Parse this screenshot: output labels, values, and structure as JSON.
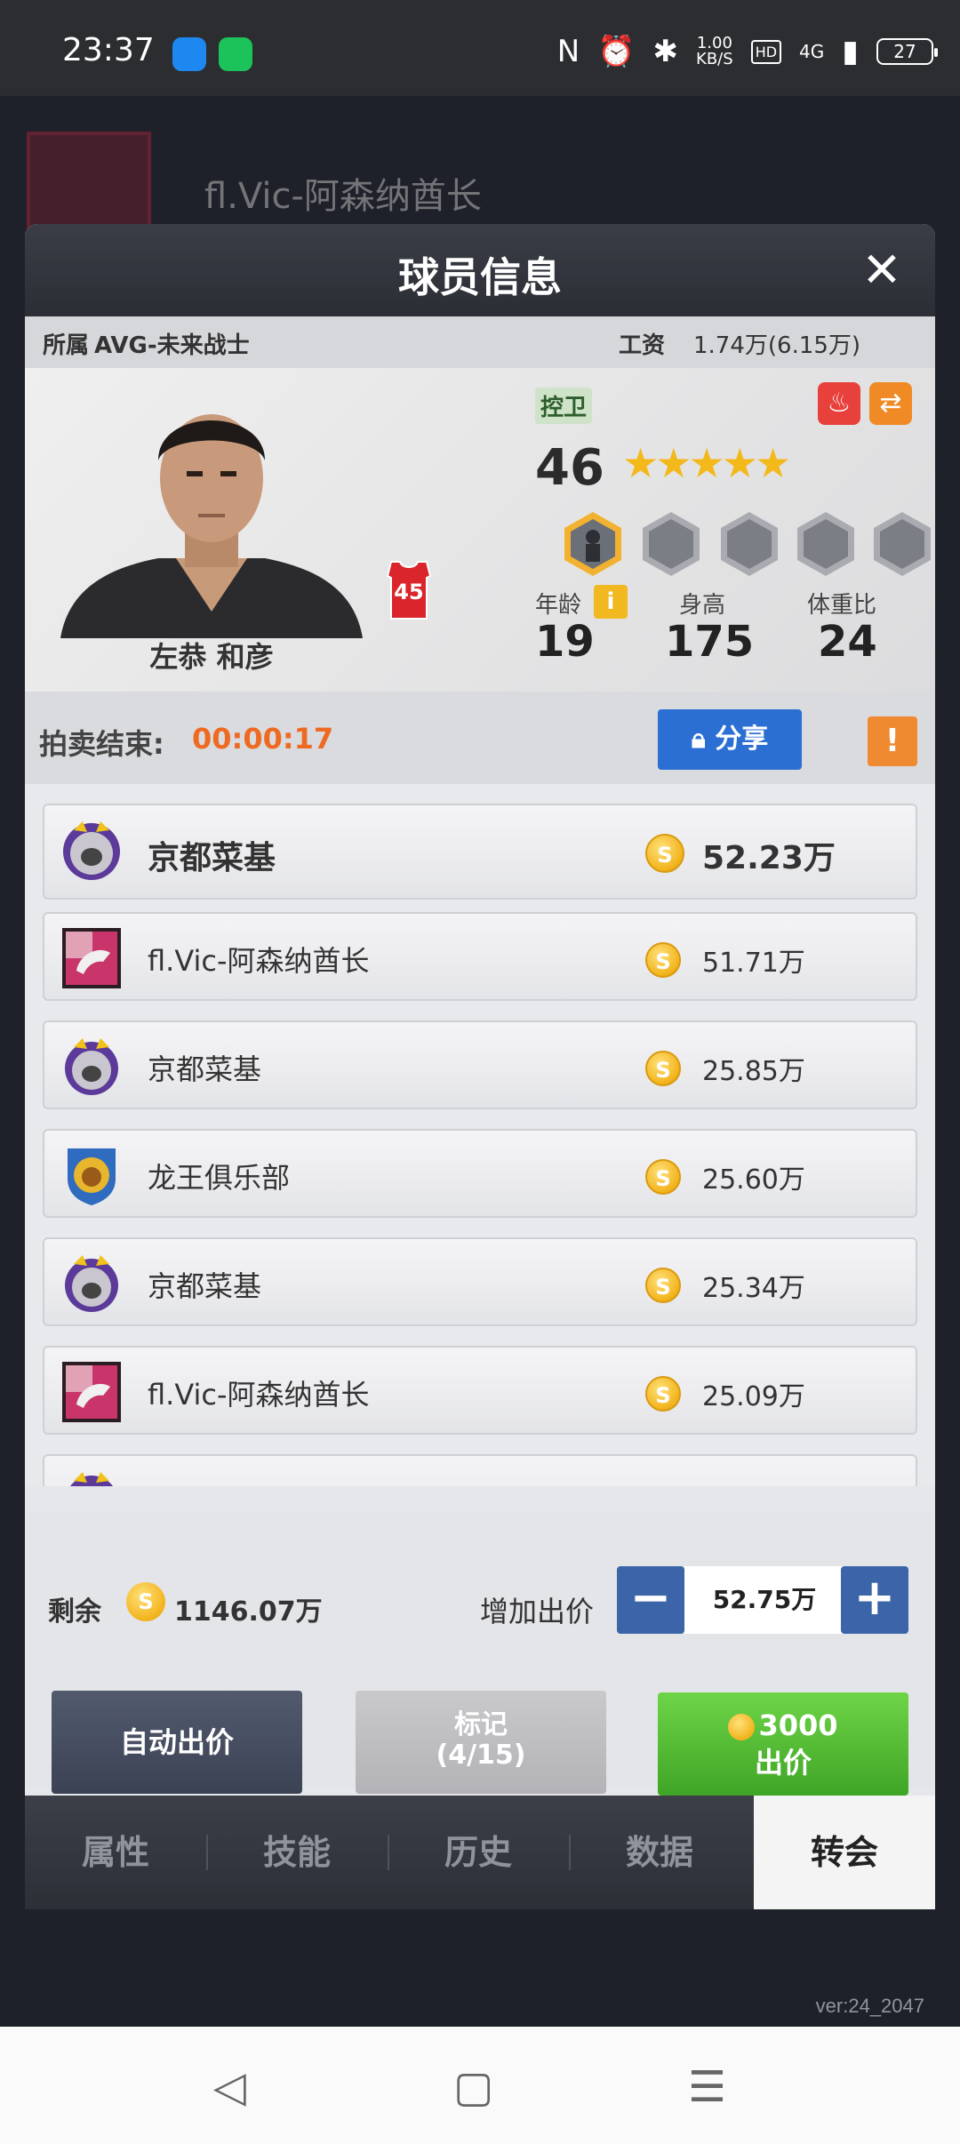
{
  "status_bar": {
    "time": "23:37",
    "speed_value": "1.00",
    "speed_unit": "KB/S",
    "hd": "HD",
    "network": "4G",
    "battery": "27"
  },
  "background": {
    "team_name": "fl.Vic-阿森纳酋长",
    "version": "ver:24_2047"
  },
  "modal": {
    "title": "球员信息",
    "close": "✕",
    "info": {
      "team_label": "所属",
      "team_value": "AVG-未来战士",
      "salary_label": "工资",
      "salary_value": "1.74万(6.15万)"
    },
    "player": {
      "name": "左恭 和彦",
      "jersey_number": "45",
      "position": "控卫",
      "rating": "46",
      "stars": 4.5,
      "stars_text": "★★★★★",
      "age_label": "年龄",
      "age_value": "19",
      "height_label": "身高",
      "height_value": "175",
      "weight_label": "体重比",
      "weight_value": "24",
      "info_icon": "i"
    },
    "auction": {
      "label": "拍卖结束:",
      "time": "00:00:17",
      "share_label": "分享",
      "warn": "!"
    },
    "bids": [
      {
        "team": "京都菜基",
        "amount": "52.23万",
        "logo": "wolf-logo"
      },
      {
        "team": "fl.Vic-阿森纳酋长",
        "amount": "51.71万",
        "logo": "dragon-logo"
      },
      {
        "team": "京都菜基",
        "amount": "25.85万",
        "logo": "wolf-logo"
      },
      {
        "team": "龙王俱乐部",
        "amount": "25.60万",
        "logo": "lion-logo"
      },
      {
        "team": "京都菜基",
        "amount": "25.34万",
        "logo": "wolf-logo"
      },
      {
        "team": "fl.Vic-阿森纳酋长",
        "amount": "25.09万",
        "logo": "dragon-logo"
      }
    ],
    "coin_symbol": "S",
    "bottom": {
      "remain_label": "剩余",
      "remain_value": "1146.07万",
      "increase_label": "增加出价",
      "minus": "−",
      "plus": "+",
      "bid_value": "52.75万",
      "auto_bid": "自动出价",
      "mark_line1": "标记",
      "mark_line2": "(4/15)",
      "bid_cost": "3000",
      "bid_label": "出价"
    },
    "tabs": [
      "属性",
      "技能",
      "历史",
      "数据",
      "转会"
    ],
    "active_tab": "转会"
  },
  "colors": {
    "accent_blue": "#2b6fd3",
    "timer_orange": "#ee6a22",
    "bid_green": "#4fb82f",
    "coin_gold": "#f2b31c"
  }
}
